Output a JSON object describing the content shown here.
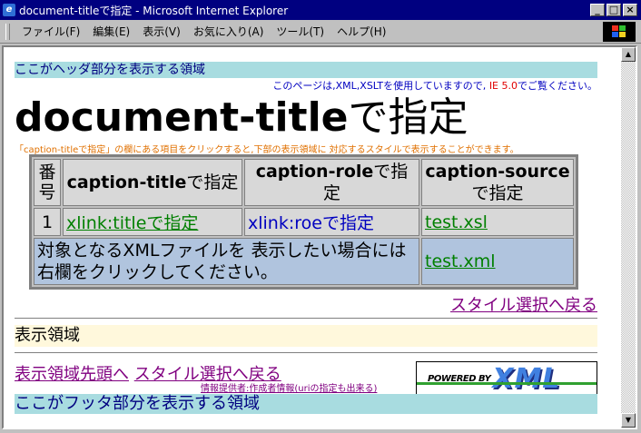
{
  "window": {
    "title": "document-titleで指定 - Microsoft Internet Explorer",
    "buttons": [
      "_",
      "□",
      "×"
    ]
  },
  "menu": [
    "ファイル(F)",
    "編集(E)",
    "表示(V)",
    "お気に入り(A)",
    "ツール(T)",
    "ヘルプ(H)"
  ],
  "page": {
    "header_band": "ここがヘッダ部分を表示する領域",
    "notice_prefix": "このページは,XML,XSLTを使用していますので, ",
    "notice_ie": "IE 5.0",
    "notice_suffix": "でご覧ください。",
    "title_en": "document-title",
    "title_jp": "で指定",
    "subnote": "「caption-titleで指定」の欄にある項目をクリックすると,下部の表示領域に 対応するスタイルで表示することができます。",
    "table": {
      "headers": [
        {
          "en": "番号",
          "jp": ""
        },
        {
          "en": "caption-title",
          "jp": "で指定"
        },
        {
          "en": "caption-role",
          "jp": "で指定"
        },
        {
          "en": "caption-source",
          "jp": "で指定"
        }
      ],
      "row1": {
        "num": "1",
        "title_link": "xlink:titleで指定",
        "role_link": "xlink:roeで指定",
        "source_link": "test.xsl"
      },
      "row2": {
        "text": "対象となるXMLファイルを 表示したい場合には 右欄をクリックしてください。",
        "link": "test.xml"
      }
    },
    "back_link_1": "スタイル選択へ戻る",
    "display_area": "表示領域",
    "nav_top_link": "表示領域先頭へ",
    "back_link_2": "スタイル選択へ戻る",
    "provider": "情報提供者:作成者情報(uriの指定も出来る)",
    "powered_text": "POWERED BY",
    "powered_xml": "XML",
    "footer_band": "ここがフッタ部分を表示する領域"
  }
}
